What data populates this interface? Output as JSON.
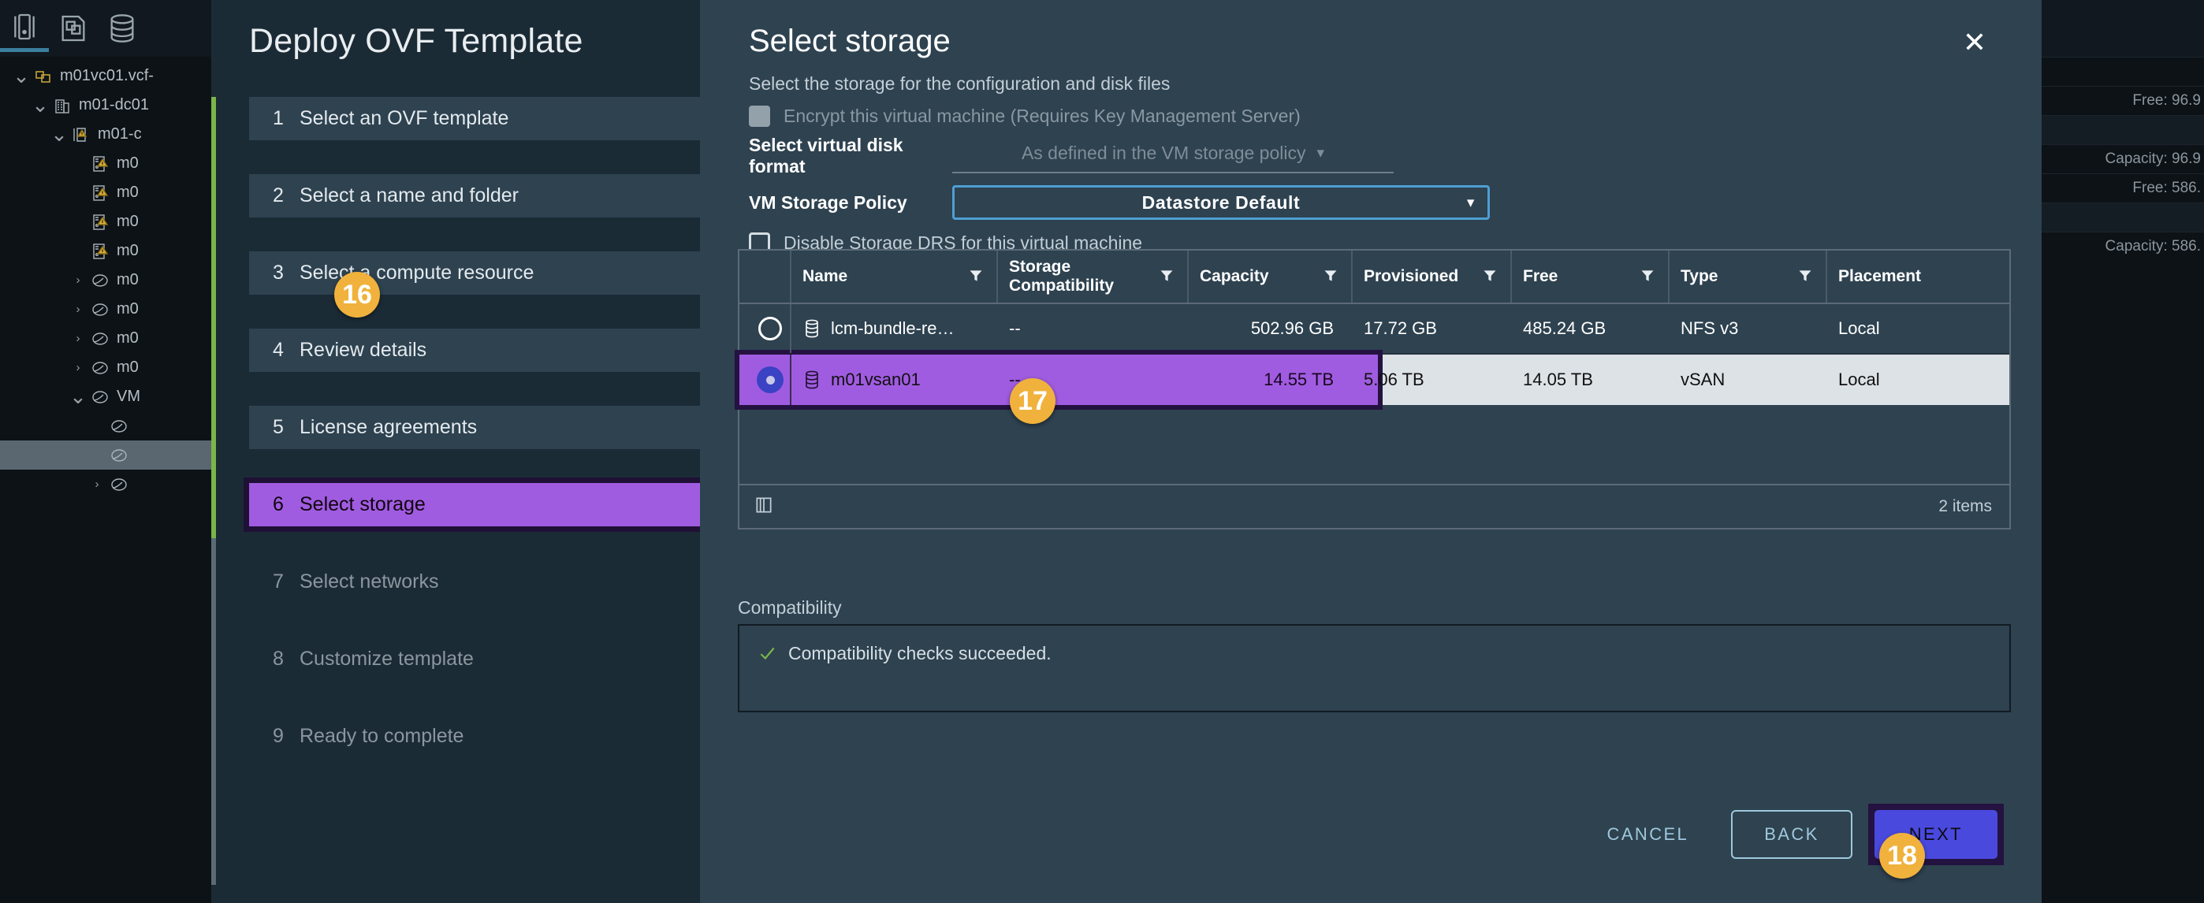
{
  "background": {
    "toolbar_icons": [
      "vm-icon",
      "templates-icon",
      "datastore-icon"
    ],
    "tree": [
      {
        "caret": "down",
        "icon": "vcenter-icon",
        "label": "m01vc01.vcf-",
        "indent": 0,
        "selected": false
      },
      {
        "caret": "down",
        "icon": "datacenter-icon",
        "label": "m01-dc01",
        "indent": 1,
        "selected": false
      },
      {
        "caret": "down",
        "icon": "cluster-warning-icon",
        "label": "m01-c",
        "indent": 2,
        "selected": false
      },
      {
        "caret": "none",
        "icon": "host-warning-icon",
        "label": "m0",
        "indent": 3,
        "selected": false
      },
      {
        "caret": "none",
        "icon": "host-warning-icon",
        "label": "m0",
        "indent": 3,
        "selected": false
      },
      {
        "caret": "none",
        "icon": "host-warning-icon",
        "label": "m0",
        "indent": 3,
        "selected": false
      },
      {
        "caret": "none",
        "icon": "host-warning-icon",
        "label": "m0",
        "indent": 3,
        "selected": false
      },
      {
        "caret": "right",
        "icon": "vm-circle-icon",
        "label": "m0",
        "indent": 3,
        "selected": false
      },
      {
        "caret": "right",
        "icon": "vm-circle-icon",
        "label": "m0",
        "indent": 3,
        "selected": false
      },
      {
        "caret": "right",
        "icon": "vm-circle-icon",
        "label": "m0",
        "indent": 3,
        "selected": false
      },
      {
        "caret": "right",
        "icon": "vm-circle-icon",
        "label": "m0",
        "indent": 3,
        "selected": false
      },
      {
        "caret": "down",
        "icon": "vm-circle-icon",
        "label": "VM",
        "indent": 3,
        "selected": false
      },
      {
        "caret": "none",
        "icon": "vm-circle-icon",
        "label": "",
        "indent": 4,
        "selected": false
      },
      {
        "caret": "none",
        "icon": "vm-circle-icon",
        "label": "",
        "indent": 4,
        "selected": true
      },
      {
        "caret": "right",
        "icon": "vm-circle-icon",
        "label": "",
        "indent": 4,
        "selected": false
      }
    ],
    "right_rows": [
      {
        "text": "",
        "alt": false
      },
      {
        "text": "Free: 96.9",
        "alt": false
      },
      {
        "text": "",
        "alt": true
      },
      {
        "text": "Capacity: 96.9",
        "alt": false
      },
      {
        "text": "Free: 586.",
        "alt": false
      },
      {
        "text": "",
        "alt": true
      },
      {
        "text": "Capacity: 586.",
        "alt": false
      }
    ]
  },
  "dialog": {
    "title": "Deploy OVF Template",
    "close_label": "✕",
    "steps": [
      {
        "num": "1",
        "label": "Select an OVF template",
        "state": "done"
      },
      {
        "num": "2",
        "label": "Select a name and folder",
        "state": "done"
      },
      {
        "num": "3",
        "label": "Select a compute resource",
        "state": "done"
      },
      {
        "num": "4",
        "label": "Review details",
        "state": "done"
      },
      {
        "num": "5",
        "label": "License agreements",
        "state": "done"
      },
      {
        "num": "6",
        "label": "Select storage",
        "state": "current"
      },
      {
        "num": "7",
        "label": "Select networks",
        "state": "todo"
      },
      {
        "num": "8",
        "label": "Customize template",
        "state": "todo"
      },
      {
        "num": "9",
        "label": "Ready to complete",
        "state": "todo"
      }
    ],
    "pane": {
      "title": "Select storage",
      "subtitle": "Select the storage for the configuration and disk files",
      "encrypt_checkbox_label": "Encrypt this virtual machine (Requires Key Management Server)",
      "disk_format_label": "Select virtual disk format",
      "disk_format_value": "As defined in the VM storage policy",
      "storage_policy_label": "VM Storage Policy",
      "storage_policy_value": "Datastore Default",
      "disable_sdrs_label": "Disable Storage DRS for this virtual machine"
    },
    "table": {
      "columns": [
        {
          "key": "radio",
          "label": "",
          "filter": false
        },
        {
          "key": "name",
          "label": "Name",
          "filter": true
        },
        {
          "key": "compat",
          "label": "Storage Compatibility",
          "filter": true
        },
        {
          "key": "capacity",
          "label": "Capacity",
          "filter": true
        },
        {
          "key": "prov",
          "label": "Provisioned",
          "filter": true
        },
        {
          "key": "free",
          "label": "Free",
          "filter": true
        },
        {
          "key": "type",
          "label": "Type",
          "filter": true
        },
        {
          "key": "place",
          "label": "Placement",
          "filter": false
        }
      ],
      "rows": [
        {
          "selected": false,
          "name": "lcm-bundle-re…",
          "compat": "--",
          "capacity": "502.96 GB",
          "prov": "17.72 GB",
          "free": "485.24 GB",
          "type": "NFS v3",
          "place": "Local"
        },
        {
          "selected": true,
          "name": "m01vsan01",
          "compat": "--",
          "capacity": "14.55 TB",
          "prov": "5.06 TB",
          "free": "14.05 TB",
          "type": "vSAN",
          "place": "Local"
        }
      ],
      "item_count": "2 items",
      "columns_toggle_icon": "columns-icon"
    },
    "compatibility": {
      "label": "Compatibility",
      "status_icon": "check-icon",
      "message": "Compatibility checks succeeded."
    },
    "footer": {
      "cancel": "CANCEL",
      "back": "BACK",
      "next": "NEXT"
    }
  },
  "annotations": [
    {
      "id": "16",
      "target": "step-select-storage"
    },
    {
      "id": "17",
      "target": "datastore-row-m01vsan01"
    },
    {
      "id": "18",
      "target": "next-button"
    }
  ],
  "colors": {
    "highlight_purple": "#a05ce0",
    "badge_orange": "#f0b23c",
    "accent_blue": "#4a49de",
    "rail_green": "#7ab648",
    "focus_blue": "#4f9fd4"
  }
}
